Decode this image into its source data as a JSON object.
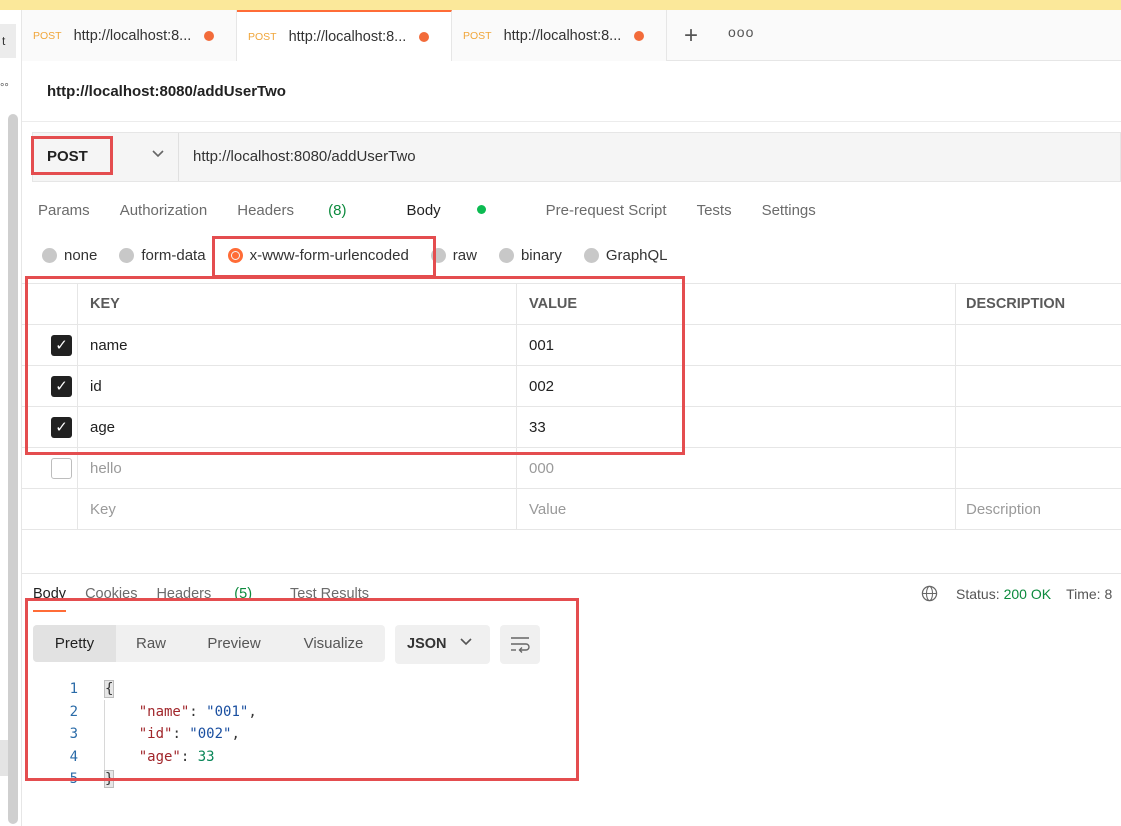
{
  "tabs": [
    {
      "method": "POST",
      "title": "http://localhost:8..."
    },
    {
      "method": "POST",
      "title": "http://localhost:8..."
    },
    {
      "method": "POST",
      "title": "http://localhost:8..."
    }
  ],
  "tab_new": "+",
  "tab_more": "ooo",
  "left_stub": "t",
  "left_dots": "°°",
  "request": {
    "title": "http://localhost:8080/addUserTwo",
    "method": "POST",
    "url": "http://localhost:8080/addUserTwo"
  },
  "request_tabs": {
    "params": "Params",
    "authorization": "Authorization",
    "headers": "Headers",
    "headers_count": "(8)",
    "body": "Body",
    "prerequest": "Pre-request Script",
    "tests": "Tests",
    "settings": "Settings"
  },
  "body_modes": {
    "none": "none",
    "form_data": "form-data",
    "urlencoded": "x-www-form-urlencoded",
    "raw": "raw",
    "binary": "binary",
    "graphql": "GraphQL",
    "selected": "x-www-form-urlencoded"
  },
  "kv_table": {
    "headers": {
      "key": "KEY",
      "value": "VALUE",
      "description": "DESCRIPTION"
    },
    "rows": [
      {
        "checked": true,
        "key": "name",
        "value": "001"
      },
      {
        "checked": true,
        "key": "id",
        "value": "002"
      },
      {
        "checked": true,
        "key": "age",
        "value": "33"
      },
      {
        "checked": false,
        "key": "hello",
        "value": "000"
      }
    ],
    "placeholder": {
      "key": "Key",
      "value": "Value",
      "description": "Description"
    }
  },
  "response": {
    "tabs": {
      "body": "Body",
      "cookies": "Cookies",
      "headers": "Headers",
      "headers_count": "(5)",
      "test_results": "Test Results"
    },
    "status_label": "Status:",
    "status_value": "200 OK",
    "time_label": "Time: 8",
    "views": {
      "pretty": "Pretty",
      "raw": "Raw",
      "preview": "Preview",
      "visualize": "Visualize"
    },
    "format": "JSON",
    "code": {
      "line_numbers": [
        "1",
        "2",
        "3",
        "4",
        "5"
      ],
      "open_brace": "{",
      "close_brace": "}",
      "fields": [
        {
          "key": "\"name\"",
          "value": "\"001\"",
          "sep": ",",
          "kind": "str"
        },
        {
          "key": "\"id\"",
          "value": "\"002\"",
          "sep": ",",
          "kind": "str"
        },
        {
          "key": "\"age\"",
          "value": "33",
          "sep": "",
          "kind": "num"
        }
      ]
    }
  },
  "colors": {
    "accent": "#ff6c37",
    "highlight": "#e44d4f",
    "success": "#0c8a3d"
  }
}
